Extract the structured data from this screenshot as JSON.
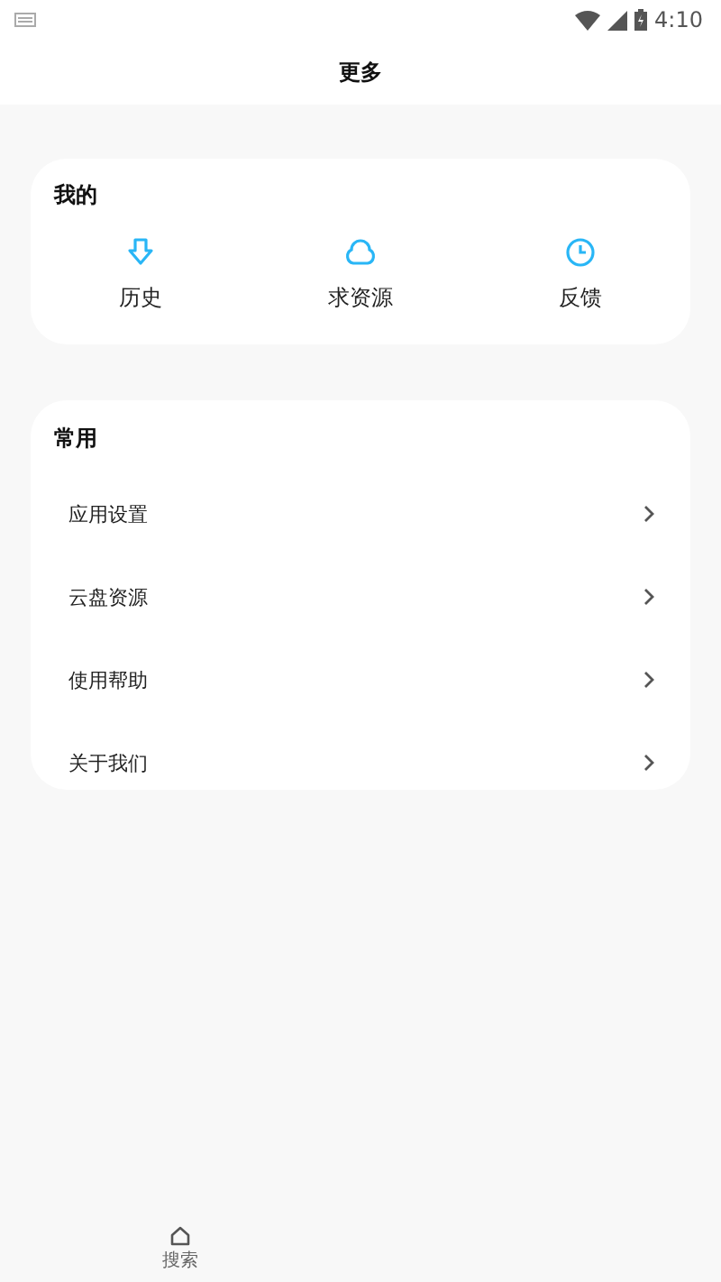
{
  "status_bar": {
    "time": "4:10"
  },
  "header": {
    "title": "更多"
  },
  "mine": {
    "title": "我的",
    "items": [
      {
        "kind": "download",
        "label": "历史"
      },
      {
        "kind": "cloud",
        "label": "求资源"
      },
      {
        "kind": "clock",
        "label": "反馈"
      }
    ]
  },
  "common": {
    "title": "常用",
    "items": [
      {
        "label": "应用设置"
      },
      {
        "label": "云盘资源"
      },
      {
        "label": "使用帮助"
      },
      {
        "label": "关于我们"
      }
    ]
  },
  "bottom_nav": [
    {
      "kind": "home",
      "label": "搜索"
    }
  ]
}
